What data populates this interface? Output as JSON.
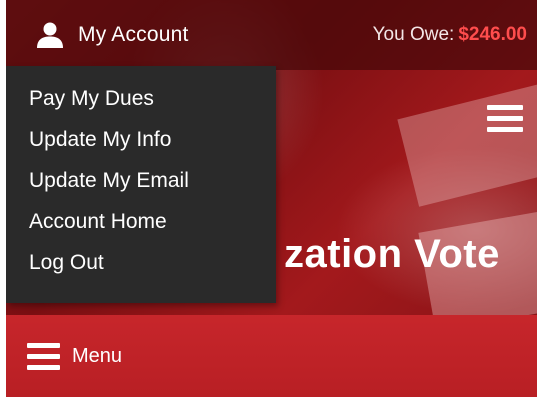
{
  "topbar": {
    "account_label": "My Account",
    "owe_label": "You Owe:",
    "owe_amount": "$246.00",
    "user_icon": "user-icon",
    "owe_color": "#ff4d4d"
  },
  "dropdown": {
    "items": [
      {
        "label": "Pay My Dues"
      },
      {
        "label": "Update My Info"
      },
      {
        "label": "Update My Email"
      },
      {
        "label": "Account Home"
      },
      {
        "label": "Log Out"
      }
    ]
  },
  "hero": {
    "title_fragment": "zation Vote",
    "menu_icon": "hamburger-icon"
  },
  "menubar": {
    "label": "Menu",
    "icon": "hamburger-icon",
    "color": "#c7262b"
  }
}
